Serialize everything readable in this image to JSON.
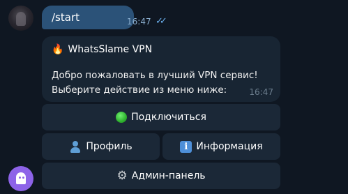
{
  "messages": {
    "outgoing": {
      "text": "/start",
      "time": "16:47",
      "status_icon": "double-check-icon"
    },
    "incoming": {
      "title_icon": "🔥",
      "title": "WhatsSlame VPN",
      "line1": "Добро пожаловать в лучший VPN сервис!",
      "line2": "Выберите действие из меню ниже:",
      "time": "16:47"
    }
  },
  "keyboard": {
    "connect_label": "Подключиться",
    "profile_label": "Профиль",
    "info_label": "Информация",
    "admin_label": "Админ-панель"
  },
  "colors": {
    "background": "#0e1621",
    "outgoing_bubble": "#2b5278",
    "incoming_bubble": "#182533",
    "keyboard_button": "#1b2837",
    "ghost_button": "#8d63e8"
  }
}
